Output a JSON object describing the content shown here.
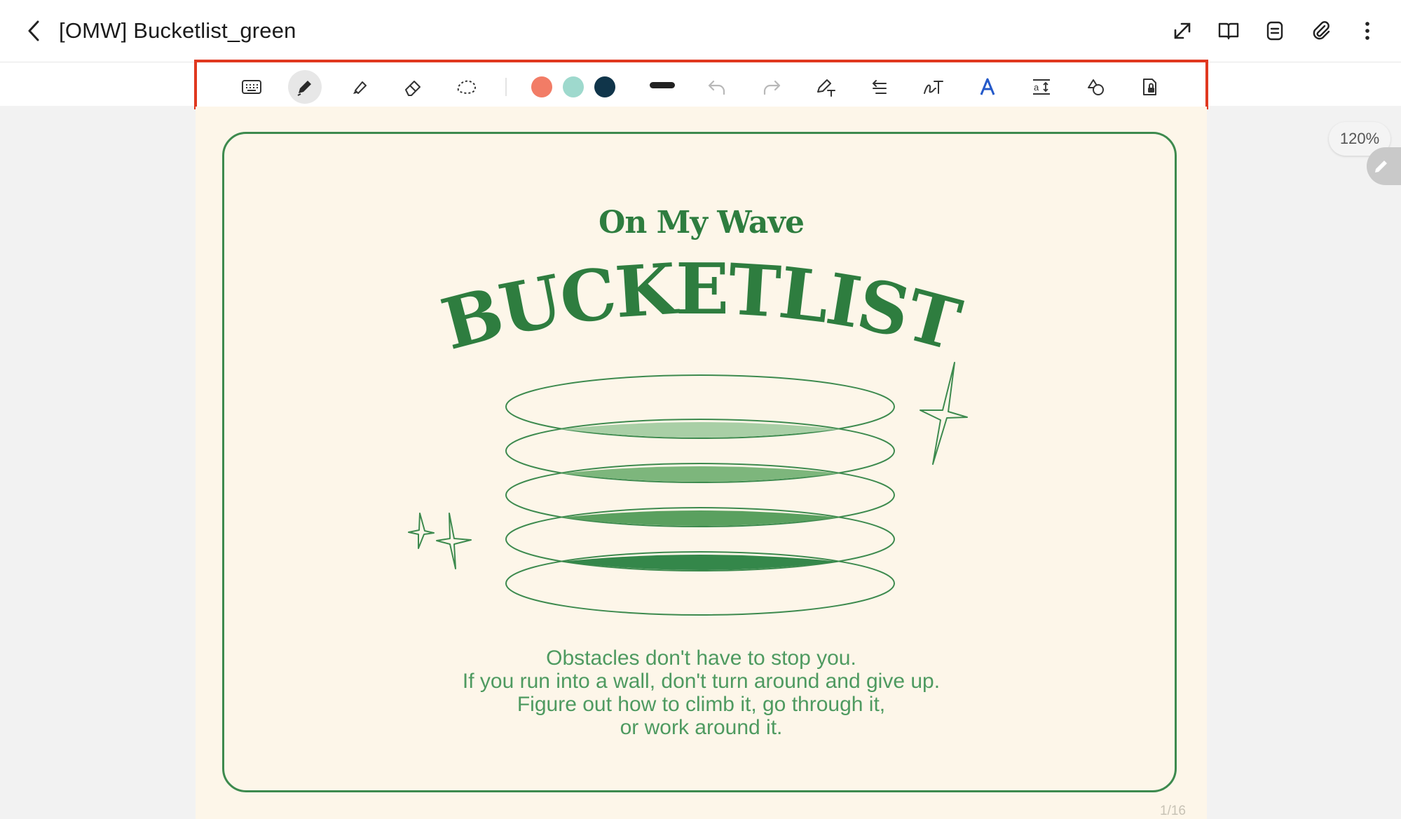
{
  "header": {
    "title": "[OMW] Bucketlist_green",
    "icons": [
      "back-arrow-icon",
      "expand-icon",
      "book-view-icon",
      "page-list-icon",
      "attach-icon",
      "more-icon"
    ]
  },
  "toolbar": {
    "tools": [
      "keyboard-icon",
      "pen-icon",
      "highlighter-icon",
      "eraser-icon",
      "lasso-icon"
    ],
    "active_tool": "pen",
    "colors": [
      "#f27c66",
      "#9ed9cd",
      "#10354a"
    ],
    "undo_enabled": false,
    "redo_enabled": false,
    "extra_tools": [
      "pen-to-text-icon",
      "text-align-icon",
      "handwriting-text-icon",
      "text-style-icon",
      "text-spacing-icon",
      "shapes-icon",
      "read-only-lock-icon"
    ],
    "highlight_color": "#e0381f"
  },
  "page": {
    "subtitle": "On My Wave",
    "heading": "BUCKETLIST",
    "quote_lines": [
      "Obstacles don't have to stop you.",
      "If you run into a wall, don't turn around and give up.",
      "Figure out how to climb it, go through it,",
      "or work around it."
    ],
    "page_indicator": "1/16",
    "accent_color": "#2e7d3f",
    "background_color": "#fdf6e9"
  },
  "zoom": {
    "label": "120%"
  }
}
